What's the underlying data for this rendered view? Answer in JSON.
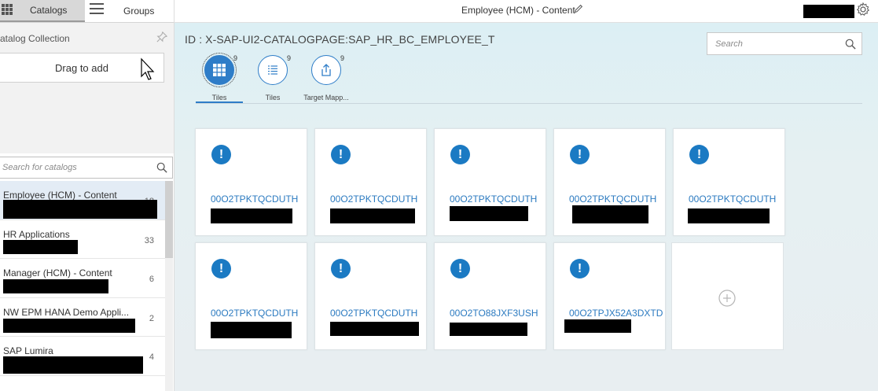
{
  "left_pane": {
    "tabs": {
      "catalogs": "Catalogs",
      "groups": "Groups"
    },
    "collection_title": "atalog Collection",
    "drag_label": "Drag to add",
    "search_placeholder": "Search for catalogs",
    "catalogs": [
      {
        "name": "Employee (HCM) - Content",
        "count": "18"
      },
      {
        "name": "HR Applications",
        "count": "33"
      },
      {
        "name": "Manager (HCM) - Content",
        "count": "6"
      },
      {
        "name": "NW EPM HANA Demo Appli...",
        "count": "2"
      },
      {
        "name": "SAP Lumira",
        "count": "4"
      }
    ]
  },
  "header": {
    "title": "Employee (HCM) - Content"
  },
  "main": {
    "catalog_id": "ID : X-SAP-UI2-CATALOGPAGE:SAP_HR_BC_EMPLOYEE_T",
    "search_placeholder": "Search",
    "view_tabs": [
      {
        "label": "Tiles",
        "count": "9",
        "icon": "tiles-grid-icon"
      },
      {
        "label": "Tiles",
        "count": "9",
        "icon": "tiles-list-icon"
      },
      {
        "label": "Target Mapp...",
        "count": "9",
        "icon": "target-mapping-icon"
      }
    ],
    "tiles": [
      {
        "title": "00O2TPKTQCDUTH"
      },
      {
        "title": "00O2TPKTQCDUTH"
      },
      {
        "title": "00O2TPKTQCDUTH"
      },
      {
        "title": "00O2TPKTQCDUTH"
      },
      {
        "title": "00O2TPKTQCDUTH"
      },
      {
        "title": "00O2TPKTQCDUTH"
      },
      {
        "title": "00O2TPKTQCDUTH"
      },
      {
        "title": "00O2TO88JXF3USH"
      },
      {
        "title": "00O2TPJX52A3DXTD"
      }
    ],
    "warning_glyph": "!"
  },
  "colors": {
    "accent": "#2e7dc8",
    "tile_link": "#2b7ac0",
    "main_bg": "#dceff4"
  }
}
